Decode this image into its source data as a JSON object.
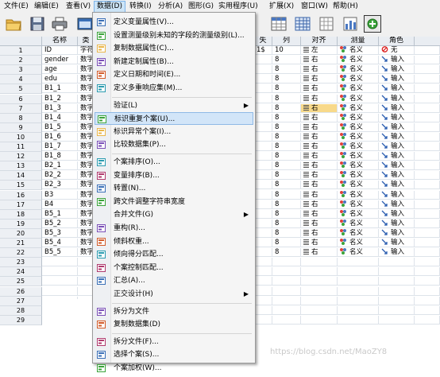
{
  "menubar": {
    "items": [
      "文件(E)",
      "编辑(E)",
      "查看(V)",
      "数据(D)",
      "转换(I)",
      "分析(A)",
      "图形(G)",
      "实用程序(U)",
      "扩展(X)",
      "窗口(W)",
      "帮助(H)"
    ]
  },
  "toolbar": {
    "icons": [
      "open-folder-icon",
      "save-icon",
      "print-icon",
      "dialog-recall-icon",
      "table-icon",
      "table-grid-icon",
      "add-on-icon"
    ]
  },
  "grid": {
    "columns": [
      "名称",
      "类",
      "",
      "",
      "",
      "",
      "失",
      "列",
      "对齐",
      "测量",
      "角色"
    ],
    "rows": [
      {
        "name": "ID",
        "type": "字符串",
        "miss": "1$",
        "col": "10",
        "align": "左",
        "measure": "名义",
        "role": "无"
      },
      {
        "name": "gender",
        "type": "数字",
        "col": "8",
        "align": "右",
        "measure": "名义",
        "role": "输入"
      },
      {
        "name": "age",
        "type": "数字",
        "col": "8",
        "align": "右",
        "measure": "名义",
        "role": "输入"
      },
      {
        "name": "edu",
        "type": "数字",
        "col": "8",
        "align": "右",
        "measure": "名义",
        "role": "输入"
      },
      {
        "name": "B1_1",
        "type": "数字",
        "col": "8",
        "align": "右",
        "measure": "名义",
        "role": "输入"
      },
      {
        "name": "B1_2",
        "type": "数字",
        "col": "8",
        "align": "右",
        "measure": "名义",
        "role": "输入"
      },
      {
        "name": "B1_3",
        "type": "数字",
        "col": "8",
        "align": "右",
        "measure": "名义",
        "role": "输入"
      },
      {
        "name": "B1_4",
        "type": "数字",
        "col": "8",
        "align": "右",
        "measure": "名义",
        "role": "输入"
      },
      {
        "name": "B1_5",
        "type": "数字",
        "col": "8",
        "align": "右",
        "measure": "名义",
        "role": "输入"
      },
      {
        "name": "B1_6",
        "type": "数字",
        "col": "8",
        "align": "右",
        "measure": "名义",
        "role": "输入"
      },
      {
        "name": "B1_7",
        "type": "数字",
        "col": "8",
        "align": "右",
        "measure": "名义",
        "role": "输入"
      },
      {
        "name": "B1_8",
        "type": "数字",
        "col": "8",
        "align": "右",
        "measure": "名义",
        "role": "输入"
      },
      {
        "name": "B2_1",
        "type": "数字",
        "col": "8",
        "align": "右",
        "measure": "名义",
        "role": "输入"
      },
      {
        "name": "B2_2",
        "type": "数字",
        "col": "8",
        "align": "右",
        "measure": "名义",
        "role": "输入"
      },
      {
        "name": "B2_3",
        "type": "数字",
        "col": "8",
        "align": "右",
        "measure": "名义",
        "role": "输入"
      },
      {
        "name": "B3",
        "type": "数字",
        "col": "8",
        "align": "右",
        "measure": "名义",
        "role": "输入"
      },
      {
        "name": "B4",
        "type": "数字",
        "col": "8",
        "align": "右",
        "measure": "名义",
        "role": "输入"
      },
      {
        "name": "B5_1",
        "type": "数字",
        "col": "8",
        "align": "右",
        "measure": "名义",
        "role": "输入"
      },
      {
        "name": "B5_2",
        "type": "数字",
        "col": "8",
        "align": "右",
        "measure": "名义",
        "role": "输入"
      },
      {
        "name": "B5_3",
        "type": "数字",
        "col": "8",
        "align": "右",
        "measure": "名义",
        "role": "输入"
      },
      {
        "name": "B5_4",
        "type": "数字",
        "col": "8",
        "align": "右",
        "measure": "名义",
        "role": "输入"
      },
      {
        "name": "B5_5",
        "type": "数字",
        "col": "8",
        "align": "右",
        "measure": "名义",
        "role": "输入"
      },
      {},
      {},
      {},
      {},
      {},
      {},
      {}
    ]
  },
  "menu": {
    "items": [
      {
        "label": "定义变量属性(V)...",
        "icon": "define-properties-icon"
      },
      {
        "label": "设置测量级别未知的字段的测量级别(L)...",
        "icon": "unknown-level-icon"
      },
      {
        "label": "复制数据属性(C)...",
        "icon": "copy-properties-icon"
      },
      {
        "label": "新建定制属性(B)...",
        "icon": "custom-attribute-icon"
      },
      {
        "label": "定义日期和时间(E)...",
        "icon": "date-time-icon"
      },
      {
        "label": "定义多重响应集(M)...",
        "icon": "multiple-response-icon"
      },
      {
        "sep": true
      },
      {
        "label": "验证(L)",
        "submenu": true
      },
      {
        "label": "标识重复个案(U)...",
        "icon": "duplicate-cases-icon",
        "highlighted": true
      },
      {
        "label": "标识异常个案(I)...",
        "icon": "unusual-cases-icon"
      },
      {
        "label": "比较数据集(P)...",
        "icon": "compare-datasets-icon"
      },
      {
        "sep": true
      },
      {
        "label": "个案排序(O)...",
        "icon": "sort-cases-icon"
      },
      {
        "label": "变量排序(B)...",
        "icon": "sort-variables-icon"
      },
      {
        "label": "转置(N)...",
        "icon": "transpose-icon"
      },
      {
        "label": "跨文件调整字符串宽度",
        "icon": "string-width-icon"
      },
      {
        "label": "合并文件(G)",
        "submenu": true
      },
      {
        "label": "重构(R)...",
        "icon": "restructure-icon"
      },
      {
        "label": "倾斜权重...",
        "icon": "rake-weights-icon"
      },
      {
        "label": "倾向得分匹配...",
        "icon": "propensity-icon"
      },
      {
        "label": "个案控制匹配...",
        "icon": "case-control-icon"
      },
      {
        "label": "汇总(A)...",
        "icon": "aggregate-icon"
      },
      {
        "label": "正交设计(H)",
        "submenu": true
      },
      {
        "sep": true
      },
      {
        "label": "拆分为文件",
        "icon": "split-file-icon"
      },
      {
        "label": "复制数据集(D)",
        "icon": "copy-dataset-icon"
      },
      {
        "sep": true
      },
      {
        "label": "拆分文件(F)...",
        "icon": "split-icon"
      },
      {
        "label": "选择个案(S)...",
        "icon": "select-cases-icon"
      },
      {
        "label": "个案加权(W)...",
        "icon": "weight-cases-icon"
      }
    ]
  },
  "watermark": "https://blog.csdn.net/MaoZY8",
  "colors": {
    "highlight": "#d2e5f8",
    "selected_cell": "#f8d98a",
    "header": "#e9edf2"
  }
}
